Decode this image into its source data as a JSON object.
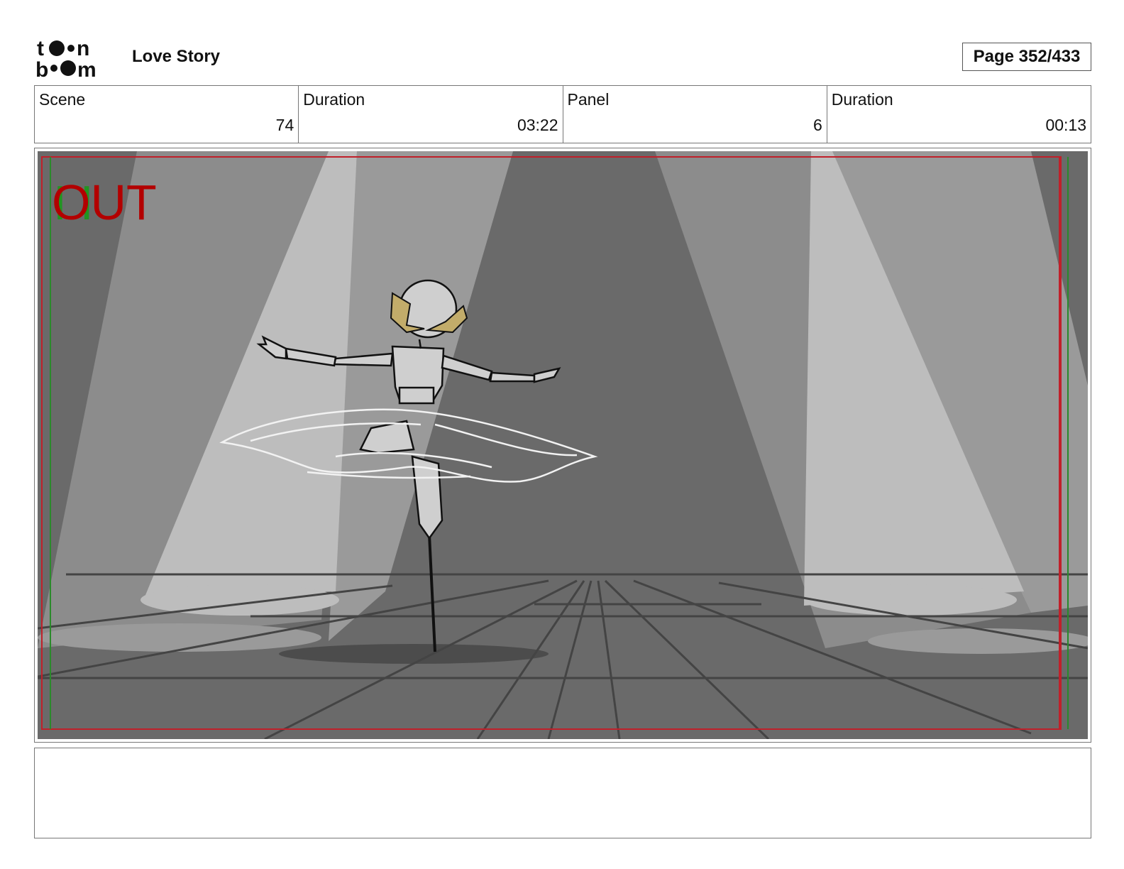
{
  "header": {
    "logo_text": "toon boom",
    "project_title": "Love Story",
    "page_label": "Page 352/433"
  },
  "info": {
    "scene_label": "Scene",
    "scene_value": "74",
    "scene_duration_label": "Duration",
    "scene_duration_value": "03:22",
    "panel_label": "Panel",
    "panel_value": "6",
    "panel_duration_label": "Duration",
    "panel_duration_value": "00:13"
  },
  "panel": {
    "overlay_text": "OUT",
    "overlay_color": "#b30000",
    "overlay_shadow_color": "#1a9a1a",
    "frame_red": "#c0202a",
    "frame_green": "#2a8a2a"
  },
  "notes": {
    "text": ""
  }
}
